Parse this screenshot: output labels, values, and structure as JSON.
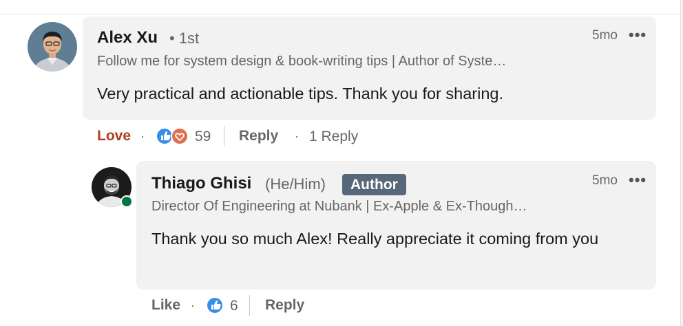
{
  "comment": {
    "author_name": "Alex Xu",
    "connection_degree": "• 1st",
    "headline": "Follow me for system design & book-writing tips | Author of Syste…",
    "timestamp": "5mo",
    "more_label": "•••",
    "text": "Very practical and actionable tips. Thank you for sharing.",
    "reaction_label": "Love",
    "reaction_label_color": "#b24020",
    "reaction_count": "59",
    "reply_label": "Reply",
    "replies_count_label": "1 Reply",
    "separator_dot": "·"
  },
  "reply": {
    "author_name": "Thiago Ghisi",
    "pronouns": "(He/Him)",
    "author_badge": "Author",
    "headline": "Director Of Engineering at Nubank | Ex-Apple & Ex-Though…",
    "timestamp": "5mo",
    "more_label": "•••",
    "text": "Thank you so much Alex! Really appreciate it coming from you",
    "reaction_label": "Like",
    "reaction_count": "6",
    "reply_label": "Reply",
    "separator_dot": "·",
    "online_status_color": "#057642"
  },
  "colors": {
    "like_blue": "#378fe9",
    "love_orange": "#df704d",
    "badge_bg": "#56687a"
  }
}
